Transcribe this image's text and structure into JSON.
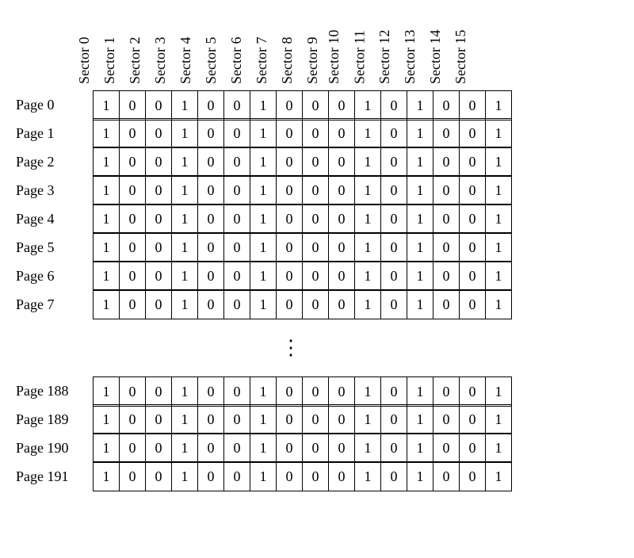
{
  "sectors": [
    "Sector 0",
    "Sector 1",
    "Sector 2",
    "Sector 3",
    "Sector 4",
    "Sector 5",
    "Sector 6",
    "Sector 7",
    "Sector 8",
    "Sector 9",
    "Sector 10",
    "Sector 11",
    "Sector 12",
    "Sector 13",
    "Sector 14",
    "Sector 15"
  ],
  "row_values": [
    1,
    0,
    0,
    1,
    0,
    0,
    1,
    0,
    0,
    0,
    1,
    0,
    1,
    0,
    0,
    1
  ],
  "top_pages": [
    "Page 0",
    "Page 1",
    "Page 2",
    "Page 3",
    "Page 4",
    "Page 5",
    "Page 6",
    "Page 7"
  ],
  "bottom_pages": [
    "Page 188",
    "Page 189",
    "Page 190",
    "Page 191"
  ],
  "vdots": "⋮"
}
